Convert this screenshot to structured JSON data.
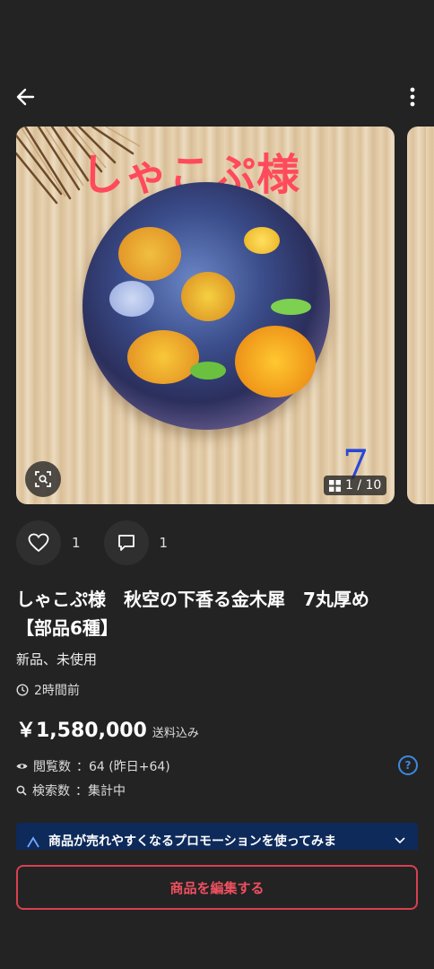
{
  "header": {
    "back_icon": "arrow-left-icon",
    "more_icon": "more-vertical-icon"
  },
  "gallery": {
    "caption": "しゃこぷ様",
    "handwritten_number": "7",
    "counter": "1 / 10",
    "scan_icon": "image-search-icon",
    "counter_icon": "grid-icon"
  },
  "actions": {
    "like_count": "1",
    "comment_count": "1"
  },
  "item": {
    "title": "しゃこぷ様　秋空の下香る金木犀　7丸厚め【部品6種】",
    "condition": "新品、未使用",
    "posted": "2時間前",
    "price": "￥1,580,000",
    "shipping": "送料込み"
  },
  "stats": {
    "views_label": "閲覧数",
    "views_value": "：64 (昨日+64)",
    "search_label": "検索数",
    "search_value": "：集計中",
    "help": "?"
  },
  "promo": {
    "text": "商品が売れやすくなるプロモーションを使ってみま"
  },
  "footer": {
    "edit_label": "商品を編集する"
  },
  "colors": {
    "background": "#232323",
    "accent": "#e84050",
    "promo_bg": "#0e2a5a"
  }
}
